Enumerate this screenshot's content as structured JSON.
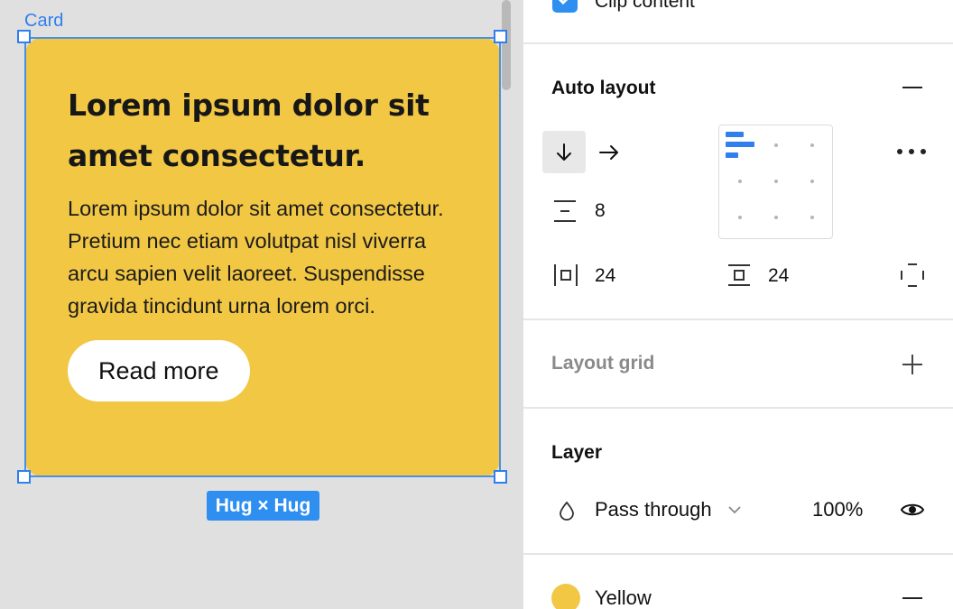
{
  "canvas": {
    "frame_label": "Card",
    "size_badge": "Hug × Hug",
    "card": {
      "title": "Lorem ipsum dolor sit amet consectetur.",
      "body": "Lorem ipsum dolor sit amet consectetur. Pretium nec etiam volutpat nisl viverra arcu sapien velit laoreet. Suspendisse gravida tincidunt urna lorem orci.",
      "button_label": "Read more",
      "background_color": "#f1c744"
    }
  },
  "panel": {
    "clip_content": {
      "label": "Clip content",
      "checked": true
    },
    "auto_layout": {
      "title": "Auto layout",
      "spacing_between": "8",
      "horizontal_padding": "24",
      "vertical_padding": "24",
      "direction": "vertical"
    },
    "layout_grid": {
      "title": "Layout grid"
    },
    "layer": {
      "title": "Layer",
      "blend_mode": "Pass through",
      "opacity": "100%"
    },
    "fill": {
      "color_name": "Yellow",
      "color": "#f1c744"
    }
  },
  "colors": {
    "accent": "#2f80ed",
    "canvas_bg": "#e0e0e0",
    "panel_bg": "#ffffff"
  }
}
